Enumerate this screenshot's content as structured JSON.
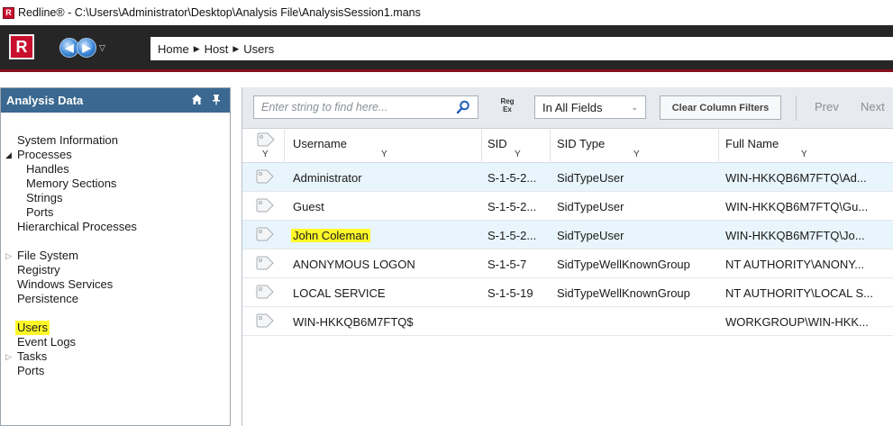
{
  "window": {
    "title": "Redline® - C:\\Users\\Administrator\\Desktop\\Analysis File\\AnalysisSession1.mans",
    "icon_letter": "R"
  },
  "toolbar": {
    "logo_letter": "R",
    "back_glyph": "◀",
    "forward_glyph": "▶",
    "dropdown_glyph": "▽",
    "breadcrumb": [
      "Home",
      "Host",
      "Users"
    ],
    "breadcrumb_separator": "▶"
  },
  "left_panel": {
    "title": "Analysis Data",
    "icons": [
      "home-icon",
      "pin-icon"
    ],
    "items": [
      {
        "label": "System Information"
      },
      {
        "label": "Processes"
      },
      {
        "label": "Handles"
      },
      {
        "label": "Memory Sections"
      },
      {
        "label": "Strings"
      },
      {
        "label": "Ports"
      },
      {
        "label": "Hierarchical Processes"
      },
      {
        "label": "File System"
      },
      {
        "label": "Registry"
      },
      {
        "label": "Windows Services"
      },
      {
        "label": "Persistence"
      },
      {
        "label": "Users"
      },
      {
        "label": "Event Logs"
      },
      {
        "label": "Tasks"
      },
      {
        "label": "Ports"
      }
    ]
  },
  "filter_bar": {
    "search_placeholder": "Enter string to find here...",
    "regex_label_top": "Reg",
    "regex_label_bottom": "Ex",
    "field_select_value": "In All Fields",
    "clear_filters_label": "Clear Column Filters",
    "prev_label": "Prev",
    "next_label": "Next"
  },
  "table": {
    "filter_glyph": "Y",
    "columns": [
      "Username",
      "SID",
      "SID Type",
      "Full Name"
    ],
    "rows": [
      {
        "username": "Administrator",
        "sid": "S-1-5-2...",
        "sid_type": "SidTypeUser",
        "full_name": "WIN-HKKQB6M7FTQ\\Ad..."
      },
      {
        "username": "Guest",
        "sid": "S-1-5-2...",
        "sid_type": "SidTypeUser",
        "full_name": "WIN-HKKQB6M7FTQ\\Gu..."
      },
      {
        "username": "John Coleman",
        "sid": "S-1-5-2...",
        "sid_type": "SidTypeUser",
        "full_name": "WIN-HKKQB6M7FTQ\\Jo..."
      },
      {
        "username": "ANONYMOUS LOGON",
        "sid": "S-1-5-7",
        "sid_type": "SidTypeWellKnownGroup",
        "full_name": "NT AUTHORITY\\ANONY..."
      },
      {
        "username": "LOCAL SERVICE",
        "sid": "S-1-5-19",
        "sid_type": "SidTypeWellKnownGroup",
        "full_name": "NT AUTHORITY\\LOCAL S..."
      },
      {
        "username": "WIN-HKKQB6M7FTQ$",
        "sid": "",
        "sid_type": "",
        "full_name": "WORKGROUP\\WIN-HKK..."
      }
    ]
  },
  "colors": {
    "panel_header": "#3b6890",
    "toolbar_bg": "#262626",
    "brand_red": "#c8102e",
    "highlight_yellow": "#fff829",
    "selected_row": "#e8f5fc"
  }
}
